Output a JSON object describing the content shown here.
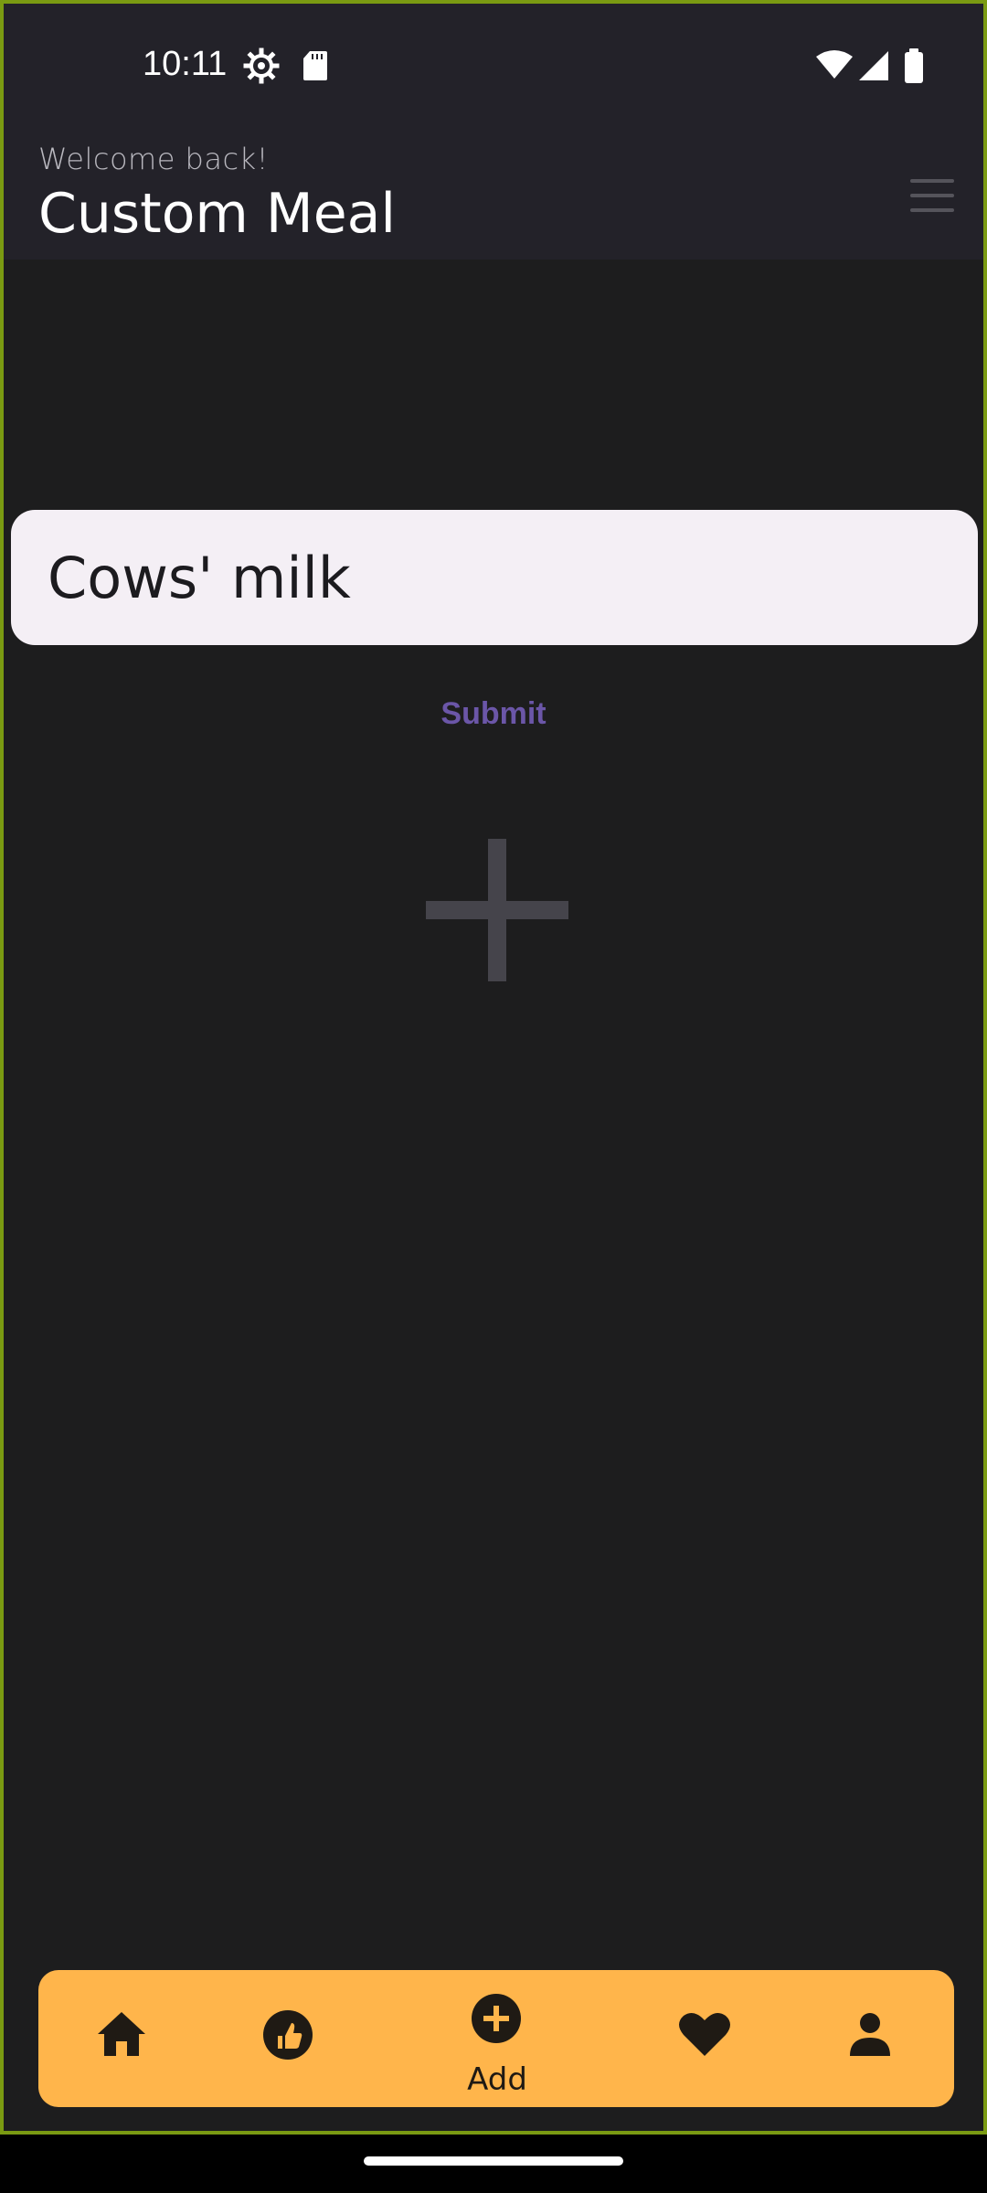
{
  "status_bar": {
    "time": "10:11",
    "icons": [
      "settings-gear-icon",
      "sd-card-icon",
      "wifi-icon",
      "signal-icon",
      "battery-icon"
    ]
  },
  "header": {
    "greeting": "Welcome back!",
    "title": "Custom Meal",
    "menu_icon": "hamburger-menu-icon"
  },
  "form": {
    "meal_input_value": "Cows' milk",
    "submit_label": "Submit",
    "add_icon": "plus-icon"
  },
  "bottom_nav": {
    "items": [
      {
        "icon": "home-icon"
      },
      {
        "icon": "thumb-up-icon"
      },
      {
        "icon": "add-circle-icon",
        "label": "Add"
      },
      {
        "icon": "heart-icon"
      },
      {
        "icon": "person-icon"
      }
    ]
  },
  "colors": {
    "background": "#1d1d1e",
    "header": "#232229",
    "input_fill": "#f4eff5",
    "submit_text": "#6b56a8",
    "nav_bar": "#ffb54b",
    "frame_border": "#7a9a12"
  }
}
